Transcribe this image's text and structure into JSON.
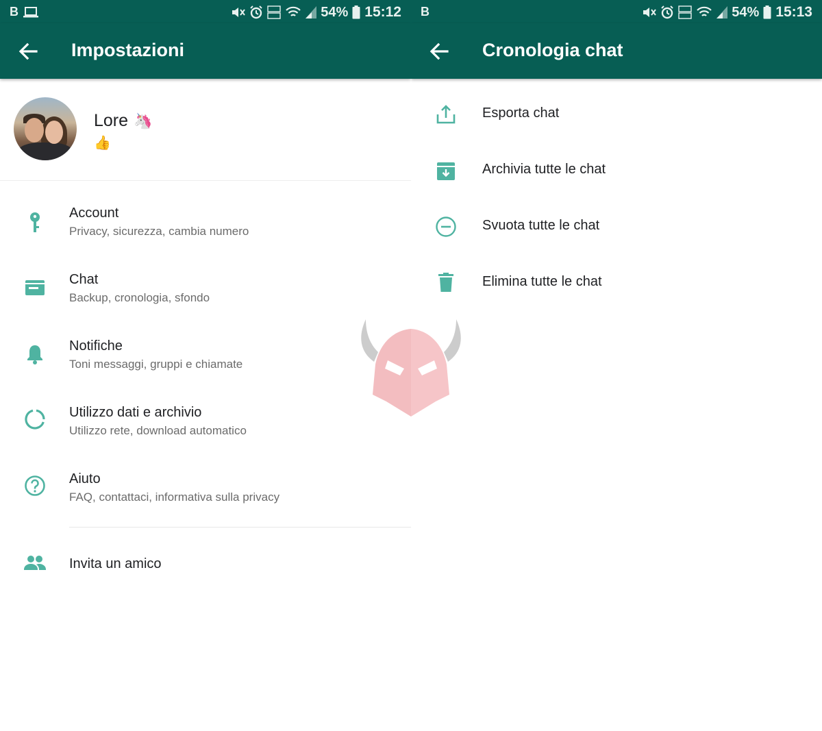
{
  "colors": {
    "primary_dark": "#075e54",
    "icon_teal": "#4fb3a1",
    "text_primary": "#202124",
    "text_secondary": "#6b6b6b"
  },
  "left": {
    "status_bar": {
      "carrier_letter": "B",
      "battery_percent": "54%",
      "time": "15:12",
      "icons": [
        "laptop-icon",
        "mute-icon",
        "alarm-icon",
        "volte-icon",
        "wifi-icon",
        "signal-icon",
        "battery-icon"
      ]
    },
    "toolbar": {
      "title": "Impostazioni",
      "back_icon": "arrow-back-icon"
    },
    "profile": {
      "name": "Lore",
      "name_emoji": "🦄",
      "status": "👍"
    },
    "settings": [
      {
        "label": "Account",
        "sub": "Privacy, sicurezza, cambia numero",
        "icon": "key-icon"
      },
      {
        "label": "Chat",
        "sub": "Backup, cronologia, sfondo",
        "icon": "chat-icon"
      },
      {
        "label": "Notifiche",
        "sub": "Toni messaggi, gruppi e chiamate",
        "icon": "bell-icon"
      },
      {
        "label": "Utilizzo dati e archivio",
        "sub": "Utilizzo rete, download automatico",
        "icon": "data-usage-icon"
      },
      {
        "label": "Aiuto",
        "sub": "FAQ, contattaci, informativa sulla privacy",
        "icon": "help-icon"
      }
    ],
    "invite": {
      "label": "Invita un amico",
      "icon": "people-icon"
    }
  },
  "right": {
    "status_bar": {
      "carrier_letter": "B",
      "battery_percent": "54%",
      "time": "15:13",
      "icons": [
        "mute-icon",
        "alarm-icon",
        "volte-icon",
        "wifi-icon",
        "signal-icon",
        "battery-icon"
      ]
    },
    "toolbar": {
      "title": "Cronologia chat",
      "back_icon": "arrow-back-icon"
    },
    "items": [
      {
        "label": "Esporta chat",
        "icon": "export-icon"
      },
      {
        "label": "Archivia tutte le chat",
        "icon": "archive-icon"
      },
      {
        "label": "Svuota tutte le chat",
        "icon": "clear-icon"
      },
      {
        "label": "Elimina tutte le chat",
        "icon": "delete-icon"
      }
    ]
  },
  "watermark": {
    "icon": "horned-helmet-logo-icon"
  }
}
